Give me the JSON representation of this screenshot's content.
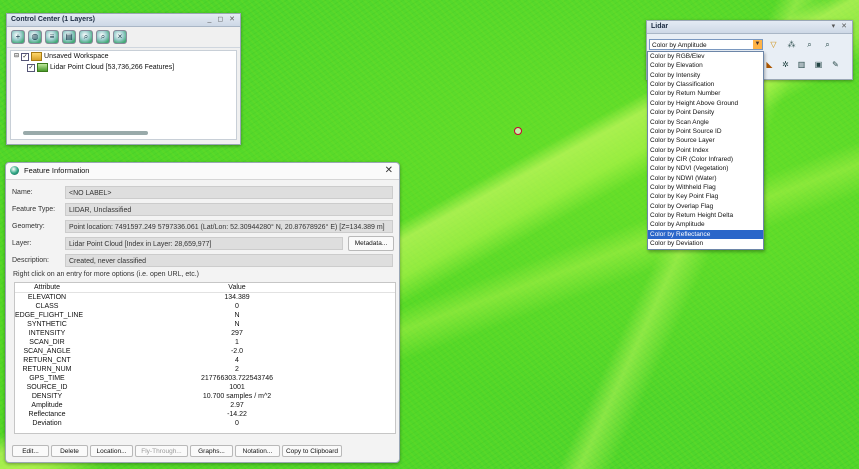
{
  "control_center": {
    "title": "Control Center (1 Layers)",
    "title_buttons": "_ ◻ ✕",
    "workspace": "Unsaved Workspace",
    "layer": "Lidar Point Cloud [53,736,266 Features]"
  },
  "feature_info": {
    "title": "Feature Information",
    "close": "✕",
    "fields": {
      "name_label": "Name:",
      "name_value": "<NO LABEL>",
      "type_label": "Feature Type:",
      "type_value": "LIDAR, Unclassified",
      "geometry_label": "Geometry:",
      "geometry_value": "Point location: 7491597.249 5797336.061 (Lat/Lon: 52.30944280° N, 20.87678926° E) [Z=134.389 m]",
      "layer_label": "Layer:",
      "layer_value": "Lidar Point Cloud [Index in Layer: 28,659,977]",
      "metadata_button": "Metadata...",
      "description_label": "Description:",
      "description_value": "Created, never classified"
    },
    "hint": "Right click on an entry for more options (i.e. open URL, etc.)",
    "table": {
      "col_attribute": "Attribute",
      "col_value": "Value",
      "rows": [
        {
          "a": "ELEVATION",
          "v": "134.389"
        },
        {
          "a": "CLASS",
          "v": "0"
        },
        {
          "a": "EDGE_FLIGHT_LINE",
          "v": "N"
        },
        {
          "a": "SYNTHETIC",
          "v": "N"
        },
        {
          "a": "INTENSITY",
          "v": "297"
        },
        {
          "a": "SCAN_DIR",
          "v": "1"
        },
        {
          "a": "SCAN_ANGLE",
          "v": "-2.0"
        },
        {
          "a": "RETURN_CNT",
          "v": "4"
        },
        {
          "a": "RETURN_NUM",
          "v": "2"
        },
        {
          "a": "GPS_TIME",
          "v": "217766303.722543746"
        },
        {
          "a": "SOURCE_ID",
          "v": "1001"
        },
        {
          "a": "DENSITY",
          "v": "10.700 samples / m^2"
        },
        {
          "a": "Amplitude",
          "v": "2.97"
        },
        {
          "a": "Reflectance",
          "v": "-14.22"
        },
        {
          "a": "Deviation",
          "v": "0"
        }
      ]
    },
    "buttons": {
      "edit": "Edit...",
      "delete": "Delete",
      "location": "Location...",
      "fly_through": "Fly-Through...",
      "graphs": "Graphs...",
      "notation": "Notation...",
      "copy": "Copy to Clipboard"
    }
  },
  "lidar_panel": {
    "title": "Lidar",
    "title_buttons": "▾ ✕",
    "selected": "Color by Amplitude",
    "options": [
      "Color by RGB/Elev",
      "Color by Elevation",
      "Color by Intensity",
      "Color by Classification",
      "Color by Return Number",
      "Color by Height Above Ground",
      "Color by Point Density",
      "Color by Scan Angle",
      "Color by Point Source ID",
      "Color by Source Layer",
      "Color by Point Index",
      "Color by CIR (Color Infrared)",
      "Color by NDVI (Vegetation)",
      "Color by NDWI (Water)",
      "Color by Withheld Flag",
      "Color by Key Point Flag",
      "Color by Overlap Flag",
      "Color by Return Height Delta",
      "Color by Amplitude",
      "Color by Reflectance",
      "Color by Deviation"
    ],
    "highlighted_index": 19
  },
  "colors": {
    "selection": "#2a66c9",
    "point_cloud_green": "#4fd62c",
    "dropdown_arrow": "#ffb347"
  }
}
